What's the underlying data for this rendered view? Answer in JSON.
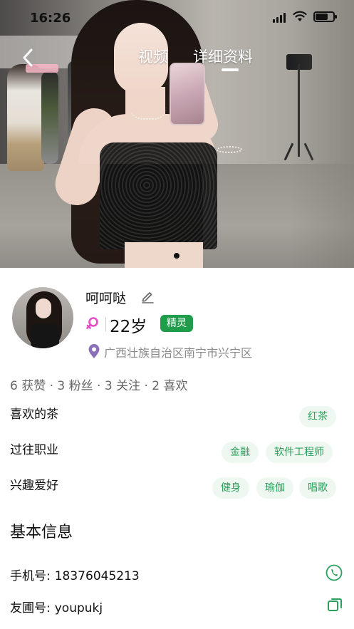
{
  "status_bar": {
    "time": "16:26",
    "battery_level": 0.7
  },
  "nav": {
    "back_icon": "chevron-left-icon",
    "tabs": [
      {
        "label": "视频",
        "active": false
      },
      {
        "label": "详细资料",
        "active": true
      }
    ]
  },
  "profile": {
    "name": "呵呵哒",
    "gender_icon": "female-icon",
    "age": "22岁",
    "badge": "精灵",
    "location": "广西壮族自治区南宁市兴宁区",
    "stats": "6 获赞 · 3 粉丝 · 3 关注 · 2 喜欢"
  },
  "attributes": [
    {
      "label": "喜欢的茶",
      "tags": [
        "红茶"
      ]
    },
    {
      "label": "过往职业",
      "tags": [
        "金融",
        "软件工程师"
      ]
    },
    {
      "label": "兴趣爱好",
      "tags": [
        "健身",
        "瑜伽",
        "唱歌"
      ]
    }
  ],
  "basic_info": {
    "title": "基本信息",
    "phone_label": "手机号:",
    "phone_value": "18376045213",
    "id_label": "友圃号:",
    "id_value": "youpukj"
  },
  "colors": {
    "accent_green": "#1f9d4a",
    "tag_text": "#2aa05a",
    "tag_bg": "#eef7f0",
    "female_pink": "#e84bc6"
  }
}
